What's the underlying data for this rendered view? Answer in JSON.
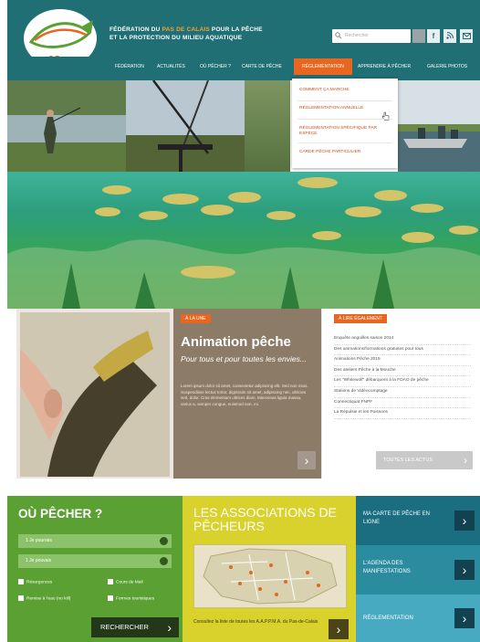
{
  "header": {
    "title_line1_prefix": "FÉDÉRATION DU ",
    "title_line1_highlight": "PAS DE CALAIS",
    "title_line1_suffix": " POUR LA PÊCHE",
    "title_line2": "ET LA PROTECTION DU MILIEU AQUATIQUE",
    "logo_number": "62",
    "search_placeholder": "Rechercher",
    "social": [
      "f",
      "rss",
      "mail"
    ]
  },
  "nav": {
    "items": [
      "FÉDÉRATION",
      "ACTUALITÉS",
      "OÙ PÊCHER ?",
      "CARTE DE PÊCHE",
      "RÉGLEMENTATION",
      "APPRENDRE À PÊCHER",
      "GALERIE PHOTOS"
    ],
    "active_index": 4
  },
  "dropdown": {
    "items": [
      "COMMENT ÇA MARCHE",
      "RÉGLEMENTATION ANNUELLE",
      "RÉGLEMENTATION SPÉCIFIQUE PAR ESPÈCE",
      "CARDE PÊCHE PARTICULIER"
    ]
  },
  "feature": {
    "badge": "À LA UNE",
    "title": "Animation pêche",
    "subtitle": "Pour tous et pour toutes les envies...",
    "text": "Lorem ipsum dolor sit amet, consectetur adipiscing elit. Sed non risus. Suspendisse lectus tortor, dignissim sit amet, adipiscing nec, ultricies sed, dolor. Cras elementum ultrices diam. Maecenas ligula massa, varius a, semper congue, euismod non, mi."
  },
  "news": {
    "badge": "À LIRE ÉGALEMENT",
    "items": [
      "Enquête anguilles saison 2014",
      "Des animations/formations gratuites pour tous",
      "Animations Pêche 2015",
      "Des ateliers Pêche à la Mouche",
      "Les \"Whitewolf\" débarquent à la FDAO de pêche",
      "Stations de Vidéocomptage",
      "Connectiquat FNPF",
      "La Répulsie et les Poissons"
    ],
    "all_label": "TOUTES LES ACTUS"
  },
  "ou_pecher": {
    "title": "OÙ PÊCHER ?",
    "select1": "1 Je pourrais",
    "select2": "1 Je pouvais",
    "checks": [
      "Résurgences",
      "Cours de Mail",
      "Remise à l'eau (no kill)",
      "Formes touristiques"
    ],
    "button": "RECHERCHER"
  },
  "associations": {
    "title": "LES ASSOCIATIONS DE PÊCHEURS",
    "text": "Consultez la liste de toutes les A.A.P.P.M.A. du Pas-de-Calais"
  },
  "tiles": [
    {
      "label": "MA CARTE DE PÊCHE EN LIGNE",
      "color": "#1a6e80"
    },
    {
      "label": "L'AGENDA DES MANIFESTATIONS",
      "color": "#2b8ca0"
    },
    {
      "label": "RÉGLEMENTATION",
      "color": "#48aac0"
    }
  ],
  "colors": {
    "teal": "#1f6f75",
    "orange": "#e8661f",
    "green": "#5aa032",
    "yellow": "#d9d12c"
  }
}
